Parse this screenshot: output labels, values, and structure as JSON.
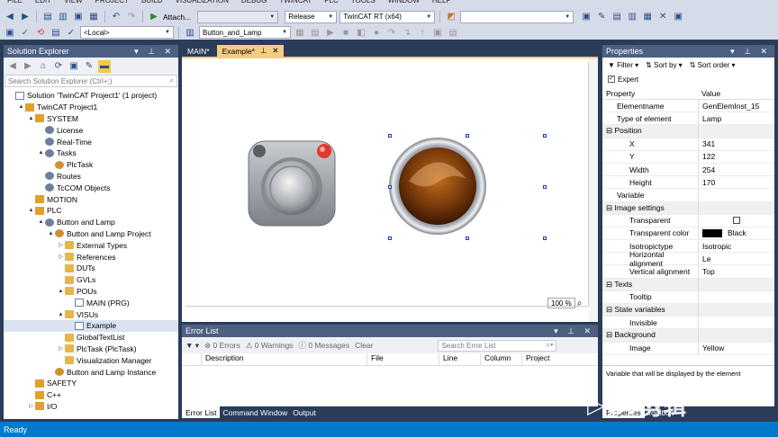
{
  "menubar": [
    "FILE",
    "EDIT",
    "VIEW",
    "PROJECT",
    "BUILD",
    "VISUALIZATION",
    "DEBUG",
    "TWINCAT",
    "PLC",
    "TOOLS",
    "WINDOW",
    "HELP"
  ],
  "toolbar": {
    "attach_label": "Attach...",
    "configuration": "Release",
    "platform": "TwinCAT RT (x64)",
    "target": "<Local>",
    "project_combo": "Button_and_Lamp"
  },
  "solution_explorer": {
    "title": "Solution Explorer",
    "search_placeholder": "Search Solution Explorer (Ctrl+;)",
    "items": [
      {
        "label": "Solution 'TwinCAT Project1' (1 project)",
        "indent": 0,
        "twisty": ""
      },
      {
        "label": "TwinCAT Project1",
        "indent": 1,
        "twisty": "▲"
      },
      {
        "label": "SYSTEM",
        "indent": 2,
        "twisty": "▲"
      },
      {
        "label": "License",
        "indent": 3,
        "twisty": ""
      },
      {
        "label": "Real-Time",
        "indent": 3,
        "twisty": ""
      },
      {
        "label": "Tasks",
        "indent": 3,
        "twisty": "▲"
      },
      {
        "label": "PlcTask",
        "indent": 4,
        "twisty": ""
      },
      {
        "label": "Routes",
        "indent": 3,
        "twisty": ""
      },
      {
        "label": "TcCOM Objects",
        "indent": 3,
        "twisty": ""
      },
      {
        "label": "MOTION",
        "indent": 2,
        "twisty": ""
      },
      {
        "label": "PLC",
        "indent": 2,
        "twisty": "▲"
      },
      {
        "label": "Button and Lamp",
        "indent": 3,
        "twisty": "▲"
      },
      {
        "label": "Button and Lamp Project",
        "indent": 4,
        "twisty": "▲"
      },
      {
        "label": "External Types",
        "indent": 5,
        "twisty": "▷"
      },
      {
        "label": "References",
        "indent": 5,
        "twisty": "▷"
      },
      {
        "label": "DUTs",
        "indent": 5,
        "twisty": ""
      },
      {
        "label": "GVLs",
        "indent": 5,
        "twisty": ""
      },
      {
        "label": "POUs",
        "indent": 5,
        "twisty": "▲"
      },
      {
        "label": "MAIN (PRG)",
        "indent": 6,
        "twisty": ""
      },
      {
        "label": "VISUs",
        "indent": 5,
        "twisty": "▲"
      },
      {
        "label": "Example",
        "indent": 6,
        "twisty": "",
        "selected": true
      },
      {
        "label": "GlobalTextList",
        "indent": 5,
        "twisty": ""
      },
      {
        "label": "PlcTask (PlcTask)",
        "indent": 5,
        "twisty": "▷"
      },
      {
        "label": "Visualization Manager",
        "indent": 5,
        "twisty": ""
      },
      {
        "label": "Button and Lamp Instance",
        "indent": 4,
        "twisty": ""
      },
      {
        "label": "SAFETY",
        "indent": 2,
        "twisty": ""
      },
      {
        "label": "C++",
        "indent": 2,
        "twisty": ""
      },
      {
        "label": "I/O",
        "indent": 2,
        "twisty": "▷"
      }
    ]
  },
  "editor": {
    "tabs": [
      {
        "label": "MAIN*",
        "active": false
      },
      {
        "label": "Example*",
        "active": true
      }
    ],
    "zoom": "100 %"
  },
  "error_list": {
    "title": "Error List",
    "errors": "0 Errors",
    "warnings": "0 Warnings",
    "messages": "0 Messages",
    "clear": "Clear",
    "search_placeholder": "Search Error List",
    "columns": [
      "Description",
      "File",
      "Line",
      "Column",
      "Project"
    ]
  },
  "bottom_tabs": [
    "Error List",
    "Command Window",
    "Output"
  ],
  "properties": {
    "title": "Properties",
    "filter": "Filter",
    "sort_by": "Sort by",
    "sort_order": "Sort order",
    "expert": "Expert",
    "col_property": "Property",
    "col_value": "Value",
    "rows": [
      {
        "k": "Elementname",
        "v": "GenElemInst_15",
        "type": "row"
      },
      {
        "k": "Type of element",
        "v": "Lamp",
        "type": "row"
      },
      {
        "k": "Position",
        "v": "",
        "type": "cat"
      },
      {
        "k": "X",
        "v": "341",
        "type": "sub"
      },
      {
        "k": "Y",
        "v": "122",
        "type": "sub"
      },
      {
        "k": "Width",
        "v": "254",
        "type": "sub"
      },
      {
        "k": "Height",
        "v": "170",
        "type": "sub"
      },
      {
        "k": "Variable",
        "v": "",
        "type": "row"
      },
      {
        "k": "Image settings",
        "v": "",
        "type": "cat"
      },
      {
        "k": "Transparent",
        "v": "",
        "type": "sub",
        "checkbox": true
      },
      {
        "k": "Transparent color",
        "v": "Black",
        "type": "sub",
        "swatch": "#000000"
      },
      {
        "k": "Isotropictype",
        "v": "Isotropic",
        "type": "sub"
      },
      {
        "k": "Horizontal alignment",
        "v": "Le",
        "type": "sub"
      },
      {
        "k": "Vertical alignment",
        "v": "Top",
        "type": "sub"
      },
      {
        "k": "Texts",
        "v": "",
        "type": "cat"
      },
      {
        "k": "Tooltip",
        "v": "",
        "type": "sub"
      },
      {
        "k": "State variables",
        "v": "",
        "type": "cat"
      },
      {
        "k": "Invisible",
        "v": "",
        "type": "sub"
      },
      {
        "k": "Background",
        "v": "",
        "type": "cat"
      },
      {
        "k": "Image",
        "v": "Yellow",
        "type": "sub"
      }
    ],
    "description": "Variable that will be displayed by the element",
    "bottom_tabs": [
      "Properties",
      "Toolbox"
    ]
  },
  "watermark": "CV剪辑",
  "status": "Ready",
  "colors": {
    "accent": "#4d6082",
    "statusbar": "#007acc",
    "tab_active": "#f5cc84"
  }
}
